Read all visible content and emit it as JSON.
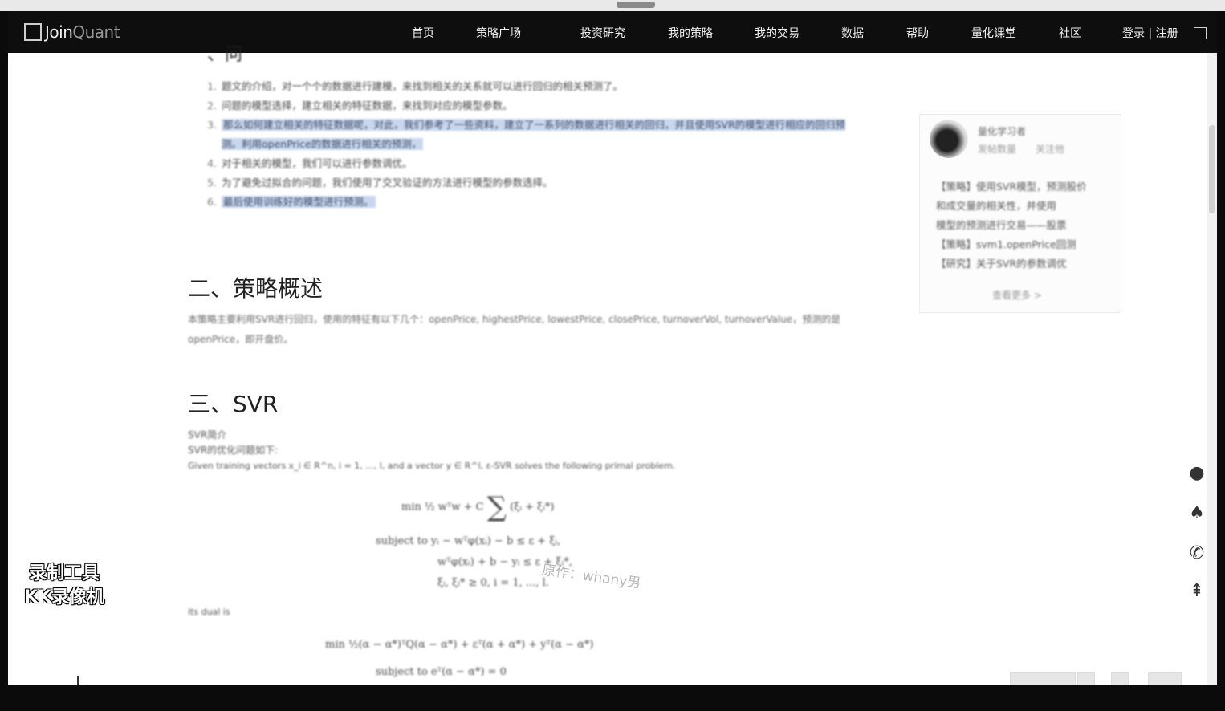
{
  "navbar": {
    "logo": {
      "text_main": "Join",
      "text_alt": "Quant"
    },
    "items": [
      {
        "label": "首页"
      },
      {
        "label": "策略广场"
      },
      {
        "label": "投资研究"
      },
      {
        "label": "我的策略"
      },
      {
        "label": "我的交易"
      },
      {
        "label": "数据"
      },
      {
        "label": "帮助"
      },
      {
        "label": "量化课堂"
      },
      {
        "label": "社区"
      }
    ],
    "auth": {
      "login": "登录",
      "separator": "|",
      "register": "注册"
    }
  },
  "article": {
    "section_partial": "、问",
    "list": [
      {
        "num": "1.",
        "text": "题文的介绍，对一个个的数据进行建模，来找到相关的关系就可以进行回归的相关预测了。"
      },
      {
        "num": "2.",
        "text": "问题的模型选择，建立相关的特征数据，来找到对应的模型参数。"
      },
      {
        "num": "3.",
        "text": "那么如何建立相关的特征数据呢，对此，我们参考了一些资料，建立了一系列的数据进行相关的回归，并且使用SVR的模型进行相应的回归预测。利用openPrice的数据进行相关的预测，"
      },
      {
        "num": "4.",
        "text": "对于相关的模型，我们可以进行参数调优。"
      },
      {
        "num": "5.",
        "text": "为了避免过拟合的问题，我们使用了交叉验证的方法进行模型的参数选择。"
      },
      {
        "num": "6.",
        "text": "最后使用训练好的模型进行预测。"
      }
    ],
    "section2_title": "二、策略概述",
    "section2_text": "本策略主要利用SVR进行回归，使用的特征有以下几个：openPrice, highestPrice, lowestPrice, closePrice, turnoverVol, turnoverValue，预测的是 openPrice，即开盘价。",
    "section3_title": "三、SVR",
    "svr_lines": [
      "SVR简介",
      "SVR的优化问题如下:",
      "Given training vectors x_i ∈ R^n, i = 1, ..., l, and a vector y ∈ R^l, ε-SVR solves the following primal problem."
    ],
    "formula1": {
      "lhs": "min",
      "body": "½ wᵀw + C",
      "tail": "(ξᵢ + ξᵢ*)",
      "s1": "subject to  yᵢ − wᵀφ(xᵢ) − b ≤ ε + ξᵢ,",
      "s2": "wᵀφ(xᵢ) + b − yᵢ ≤ ε + ξᵢ*,",
      "s3": "ξᵢ, ξᵢ* ≥ 0,  i = 1, ..., l."
    },
    "dual_label": "its dual is",
    "formula2": {
      "lhs": "min",
      "body": "½(α − α*)ᵀQ(α − α*) + εᵀ(α + α*) + yᵀ(α − α*)",
      "s1": "subject to  eᵀ(α − α*) = 0"
    }
  },
  "sidebar": {
    "user_name": "量化学习者",
    "user_meta_1": "发帖数量",
    "user_meta_2": "关注他",
    "lines": [
      "【策略】使用SVR模型，预测股价",
      "和成交量的相关性，并使用",
      "模型的预测进行交易——股票",
      "【策略】svm1.openPrice回测",
      "【研究】关于SVR的参数调优"
    ],
    "more": "查看更多 >"
  },
  "overlays": {
    "recorder_line1": "录制工具",
    "recorder_line2": "KK录像机",
    "author_mark": "原作：whany男"
  },
  "float_icons": [
    "wechat-icon",
    "qq-icon",
    "phone-icon",
    "back-to-top-icon"
  ]
}
